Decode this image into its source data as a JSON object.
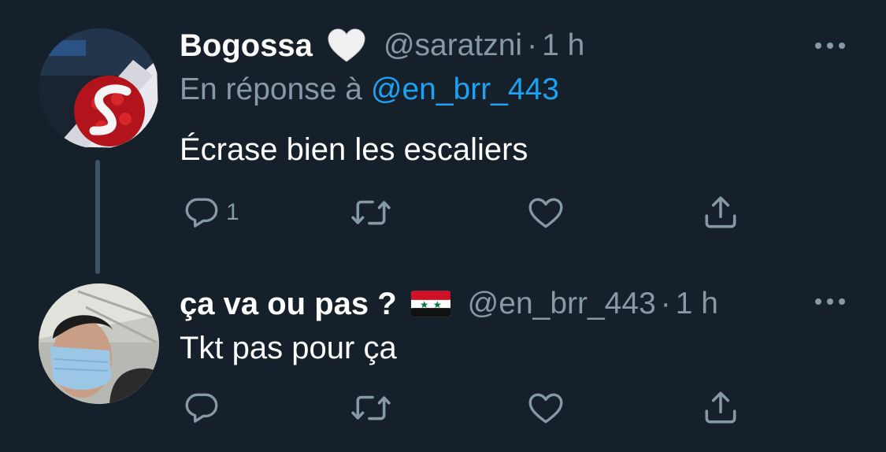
{
  "tweets": [
    {
      "display_name": "Bogossa",
      "name_emoji": "white-heart",
      "handle": "@saratzni",
      "separator": "·",
      "time": "1 h",
      "reply_prefix": "En réponse à",
      "reply_mention": "@en_brr_443",
      "text": "Écrase bien les escaliers",
      "actions": {
        "reply_count": "1"
      }
    },
    {
      "display_name": "ça va ou pas ?",
      "name_emoji": "syria-flag",
      "handle": "@en_brr_443",
      "separator": "·",
      "time": "1 h",
      "text": "Tkt pas pour ça",
      "actions": {
        "reply_count": ""
      }
    }
  ],
  "colors": {
    "background": "#15202b",
    "primary_text": "#ffffff",
    "secondary_text": "#8899a6",
    "link": "#1da1f2",
    "thread_line": "#3d5466"
  }
}
